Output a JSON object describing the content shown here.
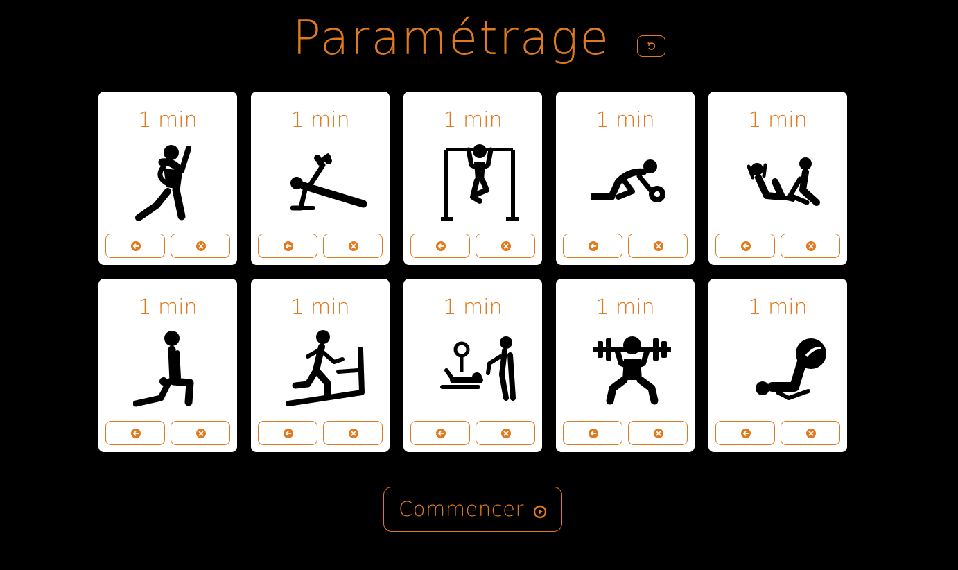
{
  "header": {
    "title": "Paramétrage",
    "reset_icon": "reset-icon"
  },
  "colors": {
    "accent": "#e07a1f",
    "background": "#000000",
    "card": "#ffffff"
  },
  "exercises": [
    {
      "duration": "1 min",
      "icon": "lunge-icon"
    },
    {
      "duration": "1 min",
      "icon": "dumbbell-plank-icon"
    },
    {
      "duration": "1 min",
      "icon": "pull-up-icon"
    },
    {
      "duration": "1 min",
      "icon": "ab-wheel-icon"
    },
    {
      "duration": "1 min",
      "icon": "partner-situp-icon"
    },
    {
      "duration": "1 min",
      "icon": "dumbbell-lunge-icon"
    },
    {
      "duration": "1 min",
      "icon": "treadmill-icon"
    },
    {
      "duration": "1 min",
      "icon": "bench-press-spotter-icon"
    },
    {
      "duration": "1 min",
      "icon": "barbell-squat-icon"
    },
    {
      "duration": "1 min",
      "icon": "ball-crunch-icon"
    }
  ],
  "card_buttons": {
    "left_icon": "arrow-left-circle-icon",
    "right_icon": "close-circle-icon"
  },
  "footer": {
    "start_label": "Commencer",
    "start_icon": "play-circle-icon"
  }
}
